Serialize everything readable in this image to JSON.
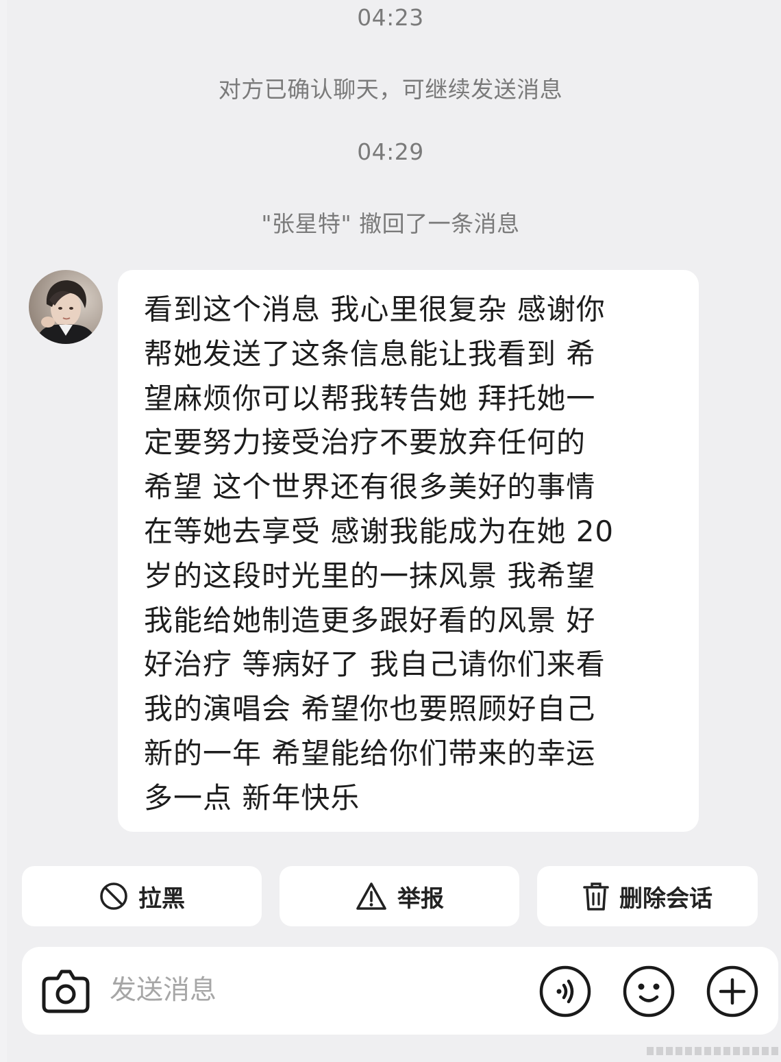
{
  "timeline": {
    "time_1": "04:23",
    "notice_1": "对方已确认聊天，可继续发送消息",
    "time_2": "04:29",
    "notice_2": "\"张星特\" 撤回了一条消息"
  },
  "message": {
    "sender_avatar": "avatar-photo",
    "text": "看到这个消息 我心里很复杂 感谢你\n帮她发送了这条信息能让我看到 希\n望麻烦你可以帮我转告她 拜托她一\n定要努力接受治疗不要放弃任何的\n希望 这个世界还有很多美好的事情\n在等她去享受 感谢我能成为在她 20\n岁的这段时光里的一抹风景 我希望\n我能给她制造更多跟好看的风景 好\n好治疗 等病好了 我自己请你们来看\n我的演唱会 希望你也要照顾好自己\n新的一年 希望能给你们带来的幸运\n多一点 新年快乐"
  },
  "actions": {
    "block_label": "拉黑",
    "block_icon": "block-icon",
    "report_label": "举报",
    "report_icon": "warning-icon",
    "delete_label": "删除会话",
    "delete_icon": "trash-icon"
  },
  "composer": {
    "placeholder": "发送消息",
    "camera_icon": "camera-icon",
    "voice_icon": "voice-icon",
    "emoji_icon": "emoji-icon",
    "plus_icon": "plus-icon"
  },
  "colors": {
    "background": "#efeff1",
    "bubble": "#ffffff",
    "system_text": "#7a7a7a",
    "placeholder": "#a6a6a6"
  }
}
